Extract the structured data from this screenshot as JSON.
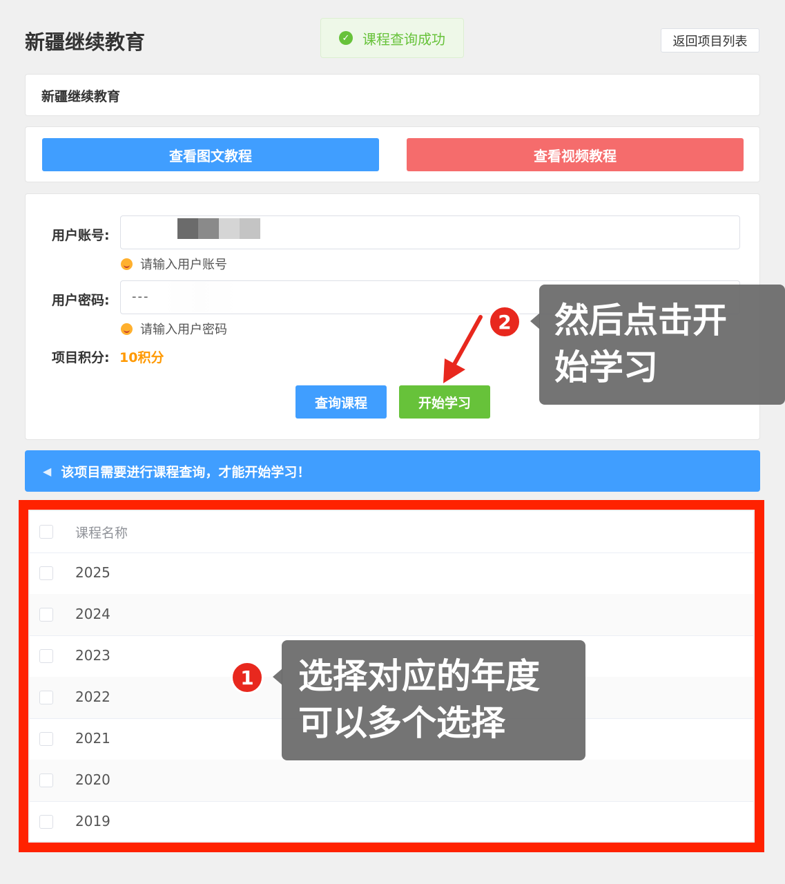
{
  "header": {
    "title": "新疆继续教育",
    "toast_text": "课程查询成功",
    "back_button": "返回项目列表"
  },
  "project": {
    "name": "新疆继续教育"
  },
  "tutorials": {
    "image_text_label": "查看图文教程",
    "video_label": "查看视频教程"
  },
  "form": {
    "account_label": "用户账号:",
    "account_hint": "请输入用户账号",
    "password_label": "用户密码:",
    "password_value": "---",
    "password_hint": "请输入用户密码",
    "points_label": "项目积分:",
    "points_value": "10积分",
    "query_button": "查询课程",
    "start_button": "开始学习"
  },
  "notice": {
    "text": "该项目需要进行课程查询，才能开始学习！"
  },
  "course_table": {
    "header": "课程名称",
    "rows": [
      "2025",
      "2024",
      "2023",
      "2022",
      "2021",
      "2020",
      "2019"
    ]
  },
  "annotations": {
    "step2_number": "2",
    "step2_line1": "然后点击开",
    "step2_line2": "始学习",
    "step1_number": "1",
    "step1_line1": "选择对应的年度",
    "step1_line2": "可以多个选择"
  },
  "colors": {
    "primary": "#409eff",
    "danger": "#f56c6c",
    "success": "#67c23a",
    "warning": "#ff9900",
    "annotation_red": "#ff2200"
  }
}
